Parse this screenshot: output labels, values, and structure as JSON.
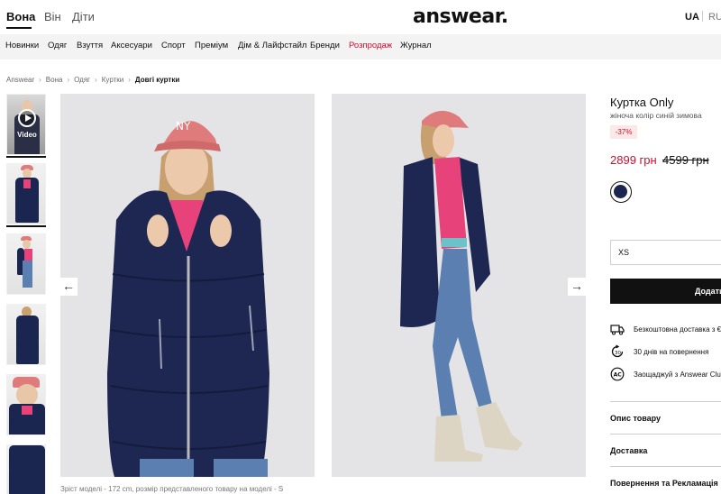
{
  "header": {
    "genders": [
      "Вона",
      "Він",
      "Діти"
    ],
    "logo": "answear.",
    "languages": [
      "UA",
      "RU"
    ]
  },
  "nav": {
    "items": [
      "Новинки",
      "Одяг",
      "Взуття",
      "Аксесуари",
      "Спорт",
      "Преміум",
      "Дім & Лайфстайл",
      "Бренди",
      "Розпродаж",
      "Журнал"
    ]
  },
  "breadcrumb": [
    "Answear",
    "Вона",
    "Одяг",
    "Куртки",
    "Довгі куртки"
  ],
  "gallery": {
    "video_label": "Video",
    "arrow_left": "←",
    "arrow_right": "→",
    "caption": "Зріст моделі - 172 cm, розмір представленого товару на моделі - S"
  },
  "product": {
    "title": "Куртка Only",
    "subtitle": "жіноча колір синій зимова",
    "discount": "-37%",
    "price_new": "2899 грн",
    "price_old": "4599 грн",
    "color": "#1b2650",
    "size": "XS",
    "add_button": "Додати",
    "features": [
      {
        "icon": "truck-icon",
        "text": "Безкоштовна доставка з €"
      },
      {
        "icon": "return-icon",
        "text": "30 днів на повернення"
      },
      {
        "icon": "club-icon",
        "text": "Заощаджуй з Answear Club"
      }
    ],
    "accordion": [
      "Опис товару",
      "Доставка",
      "Повернення та Рекламація"
    ]
  }
}
